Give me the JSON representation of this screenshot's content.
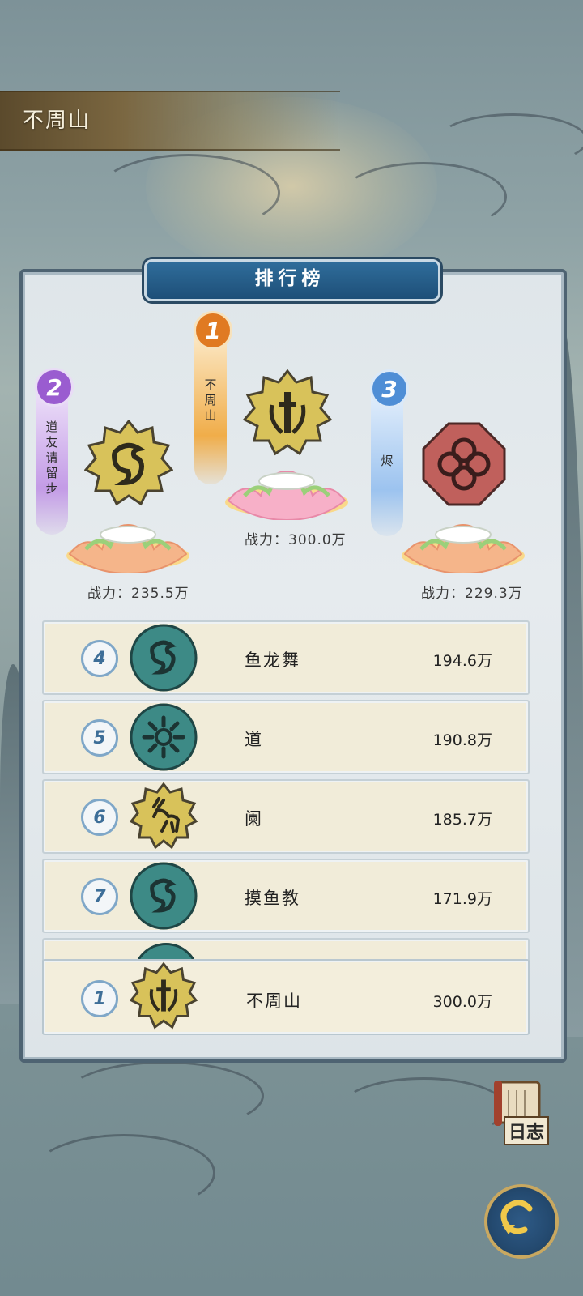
{
  "location_title": "不周山",
  "panel_title": "排行榜",
  "podium": [
    {
      "rank": "2",
      "name": "道友请留步",
      "power_label": "战力：235.5万",
      "emblem": "dragon-emblem",
      "color": "#8d55c4"
    },
    {
      "rank": "1",
      "name": "不周山",
      "power_label": "战力：300.0万",
      "emblem": "sword-emblem",
      "color": "#d98a1e"
    },
    {
      "rank": "3",
      "name": "烬",
      "power_label": "战力：229.3万",
      "emblem": "clover-emblem",
      "color": "#4f8ed6"
    }
  ],
  "list": [
    {
      "rank": "4",
      "name": "鱼龙舞",
      "power": "194.6万",
      "emblem": "dragon-emblem"
    },
    {
      "rank": "5",
      "name": "道",
      "power": "190.8万",
      "emblem": "sun-emblem"
    },
    {
      "rank": "6",
      "name": "阑",
      "power": "185.7万",
      "emblem": "deer-emblem"
    },
    {
      "rank": "7",
      "name": "摸鱼教",
      "power": "171.9万",
      "emblem": "dragon-emblem"
    }
  ],
  "my_rank": {
    "rank": "1",
    "name": "不周山",
    "power": "300.0万",
    "emblem": "sword-emblem"
  },
  "log_button_label": "日志",
  "colors": {
    "gold": "#d8c25a",
    "teal": "#3d8a86",
    "red": "#c0605c",
    "panel_header": "#2f6d9b"
  }
}
